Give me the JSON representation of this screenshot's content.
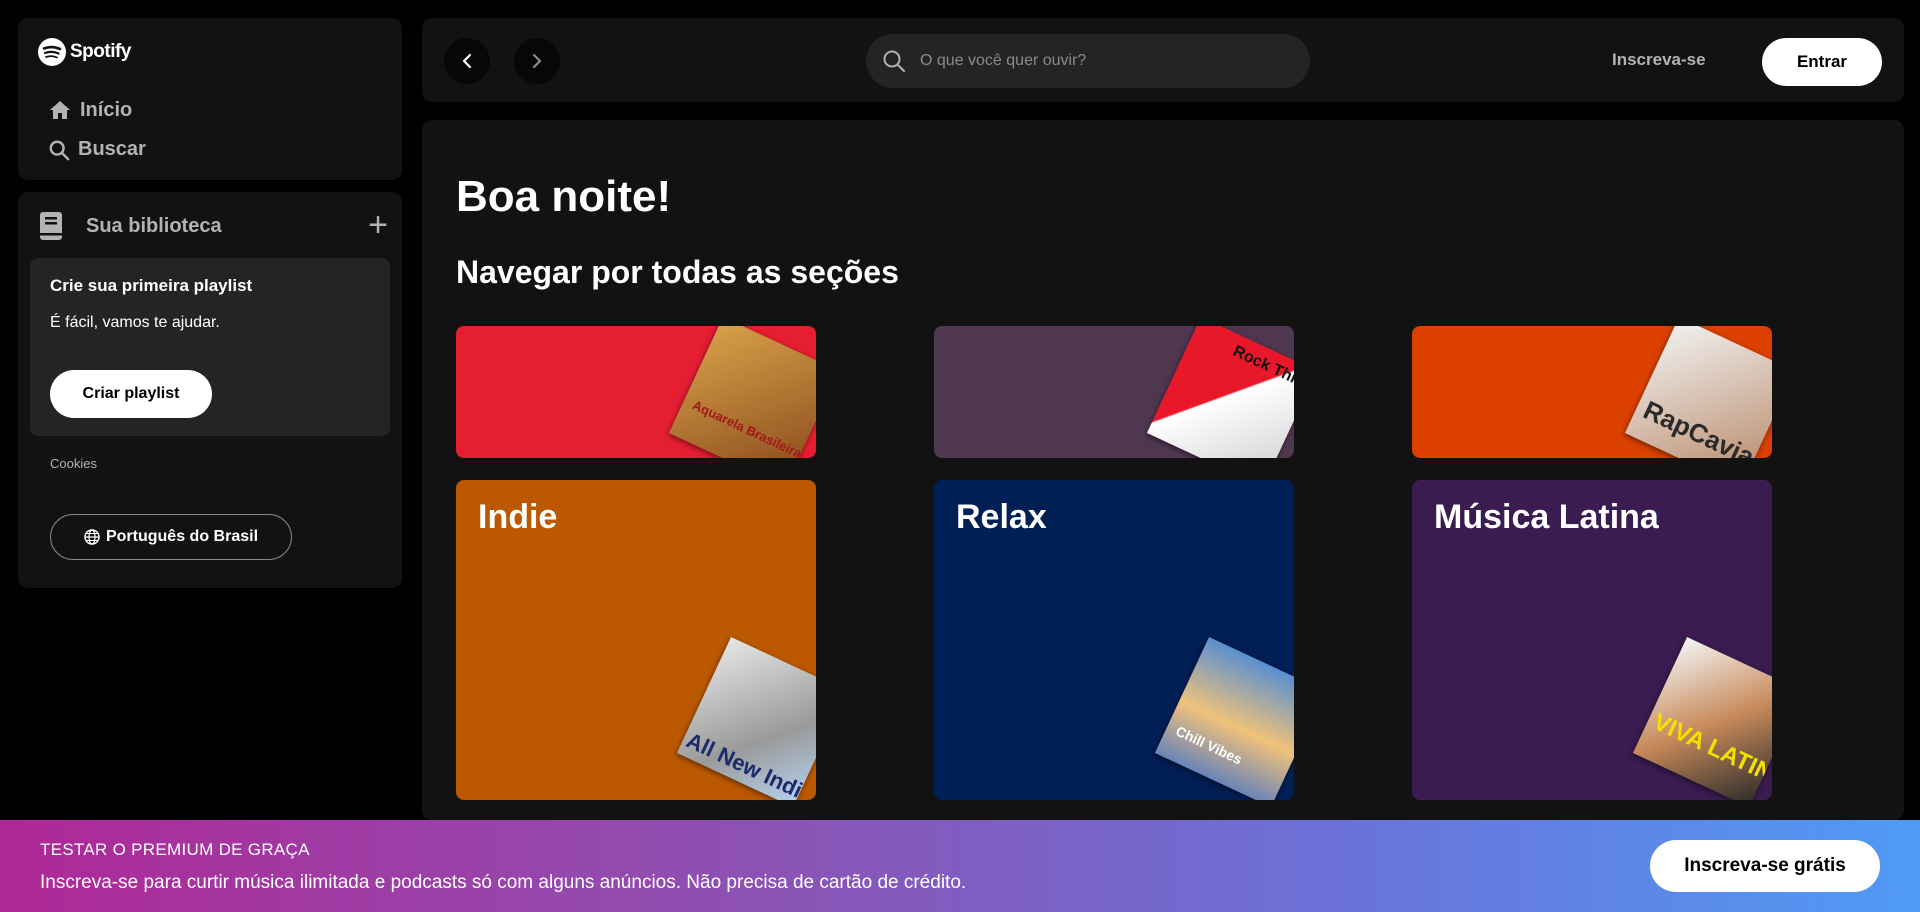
{
  "sidebar": {
    "logo_text": "Spotify",
    "nav": [
      {
        "label": "Início",
        "icon": "home-icon"
      },
      {
        "label": "Buscar",
        "icon": "search-icon"
      }
    ],
    "library": {
      "title": "Sua biblioteca",
      "add_icon": "plus-icon",
      "create_card": {
        "heading": "Crie sua primeira playlist",
        "subtext": "É fácil, vamos te ajudar.",
        "button": "Criar playlist"
      },
      "cookies": "Cookies",
      "language_button": "Português do Brasil"
    }
  },
  "topbar": {
    "search_placeholder": "O que você quer ouvir?",
    "signup": "Inscreva-se",
    "login": "Entrar"
  },
  "main": {
    "greeting": "Boa noite!",
    "section_title": "Navegar por todas as seções",
    "top_tiles": [
      {
        "color": "#e61e32",
        "cover_text": "Aquarela Brasileira"
      },
      {
        "color": "#503750",
        "cover_text": "Rock This"
      },
      {
        "color": "#dc4100",
        "cover_text": "RapCaviar"
      }
    ],
    "tiles": [
      {
        "label": "Indie",
        "color": "#bc5900",
        "cover_text": "All New Indie"
      },
      {
        "label": "Relax",
        "color": "#001f55",
        "cover_text": "Chill Vibes"
      },
      {
        "label": "Música Latina",
        "color": "#3a1c50",
        "cover_text": "VIVA LATINO"
      }
    ]
  },
  "banner": {
    "title": "TESTAR O PREMIUM DE GRAÇA",
    "subtitle": "Inscreva-se para curtir música ilimitada e podcasts só com alguns anúncios. Não precisa de cartão de crédito.",
    "button": "Inscreva-se grátis"
  }
}
